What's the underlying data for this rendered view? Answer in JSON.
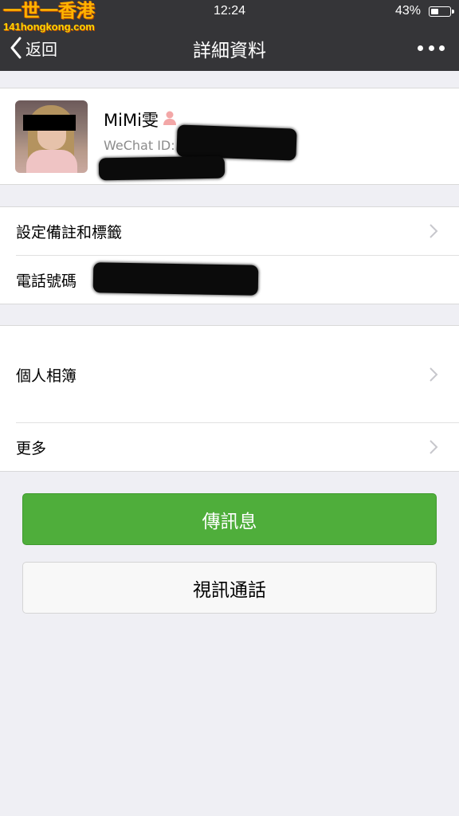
{
  "watermark": {
    "title": "一世一香港",
    "subtitle": "141hongkong.com"
  },
  "status_bar": {
    "time": "12:24",
    "battery": "43%",
    "battery_level": 0.43
  },
  "nav": {
    "back_label": "返回",
    "title": "詳細資料"
  },
  "profile": {
    "nickname": "MiMi雯",
    "wechat_id_label": "WeChat ID:"
  },
  "info_rows": {
    "remarks_label": "設定備註和標籤",
    "phone_label": "電話號碼"
  },
  "more_rows": {
    "album_label": "個人相簿",
    "more_label": "更多"
  },
  "actions": {
    "message_label": "傳訊息",
    "video_call_label": "視訊通話"
  },
  "colors": {
    "nav_bg": "#353538",
    "primary_green": "#4fae3b",
    "page_bg": "#efeff4",
    "gender_female": "#f3a7a7"
  },
  "icons": {
    "back": "chevron-left-icon",
    "more": "ellipsis-icon",
    "gender": "female-icon",
    "row_arrow": "chevron-right-icon"
  }
}
